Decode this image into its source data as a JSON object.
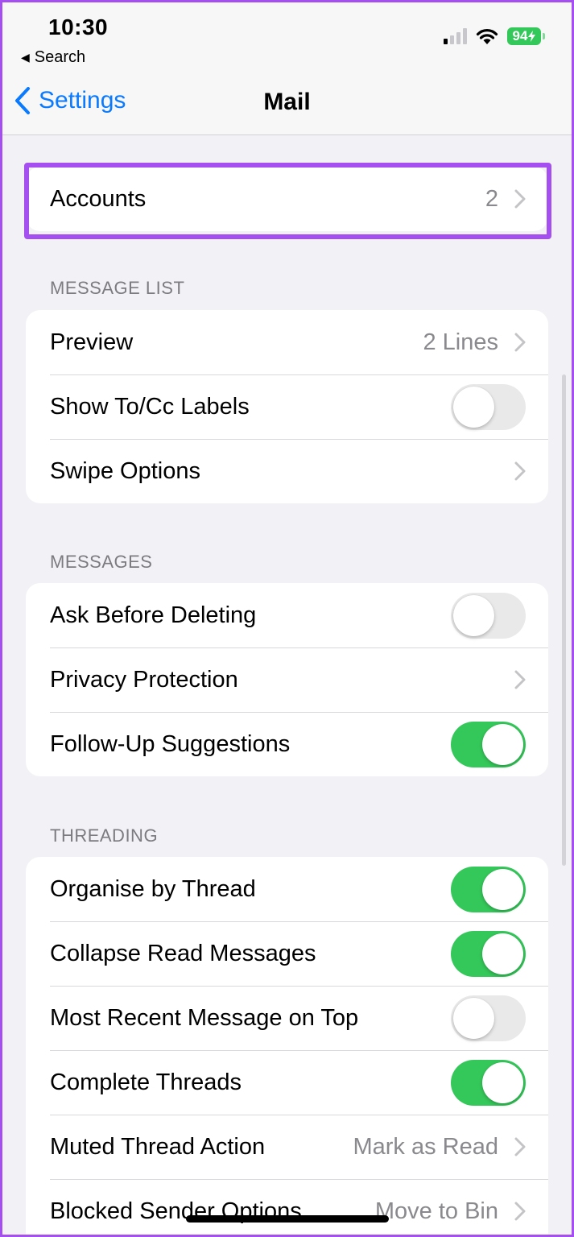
{
  "status_bar": {
    "time": "10:30",
    "back_app_label": "Search",
    "battery_percent": "94",
    "signal_bars_active": 1,
    "signal_bars_total": 4
  },
  "nav": {
    "back_label": "Settings",
    "title": "Mail"
  },
  "accounts": {
    "label": "Accounts",
    "value": "2"
  },
  "sections": [
    {
      "header": "MESSAGE LIST",
      "rows": [
        {
          "label": "Preview",
          "type": "disclosure",
          "value": "2 Lines"
        },
        {
          "label": "Show To/Cc Labels",
          "type": "toggle",
          "on": false
        },
        {
          "label": "Swipe Options",
          "type": "disclosure",
          "value": ""
        }
      ]
    },
    {
      "header": "MESSAGES",
      "rows": [
        {
          "label": "Ask Before Deleting",
          "type": "toggle",
          "on": false
        },
        {
          "label": "Privacy Protection",
          "type": "disclosure",
          "value": ""
        },
        {
          "label": "Follow-Up Suggestions",
          "type": "toggle",
          "on": true
        }
      ]
    },
    {
      "header": "THREADING",
      "rows": [
        {
          "label": "Organise by Thread",
          "type": "toggle",
          "on": true
        },
        {
          "label": "Collapse Read Messages",
          "type": "toggle",
          "on": true
        },
        {
          "label": "Most Recent Message on Top",
          "type": "toggle",
          "on": false
        },
        {
          "label": "Complete Threads",
          "type": "toggle",
          "on": true
        },
        {
          "label": "Muted Thread Action",
          "type": "disclosure",
          "value": "Mark as Read"
        },
        {
          "label": "Blocked Sender Options",
          "type": "disclosure",
          "value": "Move to Bin"
        }
      ]
    }
  ],
  "colors": {
    "accent": "#0a7aff",
    "toggle_on": "#34c759",
    "highlight": "#a64ff0"
  }
}
